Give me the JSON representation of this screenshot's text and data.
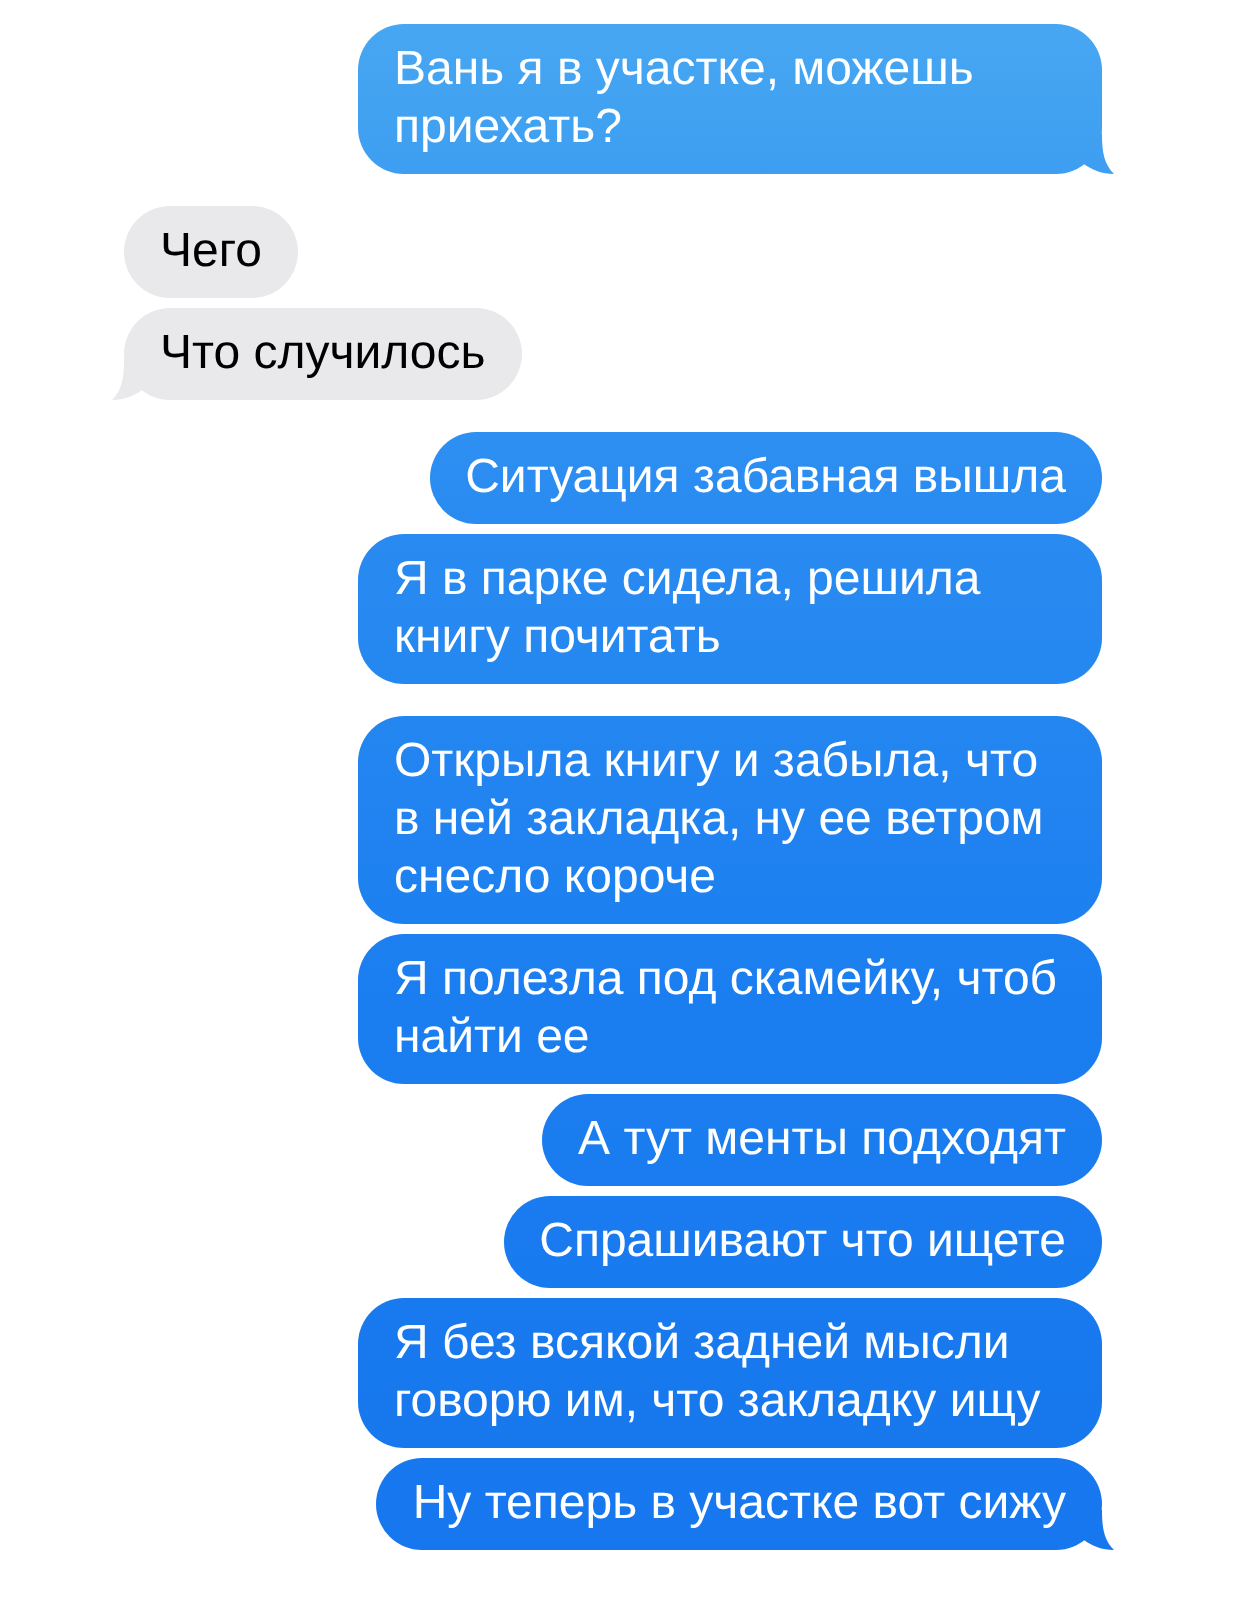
{
  "conversation": {
    "groups": [
      {
        "kind": "sent",
        "messages": [
          {
            "text": "Вань я в участке, можешь приехать?",
            "tail": true
          }
        ]
      },
      {
        "kind": "received",
        "messages": [
          {
            "text": "Чего",
            "tail": false
          },
          {
            "text": "Что случилось",
            "tail": true
          }
        ]
      },
      {
        "kind": "sent",
        "messages": [
          {
            "text": "Ситуация забавная вышла",
            "tail": false
          },
          {
            "text": "Я в парке сидела, решила книгу почитать",
            "tail": false
          }
        ]
      },
      {
        "kind": "sent",
        "messages": [
          {
            "text": "Открыла книгу и забыла, что в ней закладка, ну ее ветром снесло короче",
            "tail": false
          },
          {
            "text": "Я полезла под скамейку, чтоб найти ее",
            "tail": false
          },
          {
            "text": "А тут менты подходят",
            "tail": false
          },
          {
            "text": "Спрашивают что ищете",
            "tail": false
          },
          {
            "text": "Я без всякой задней мысли говорю им, что закладку ищу",
            "tail": false
          },
          {
            "text": "Ну теперь в участке вот сижу",
            "tail": true
          }
        ]
      }
    ]
  }
}
